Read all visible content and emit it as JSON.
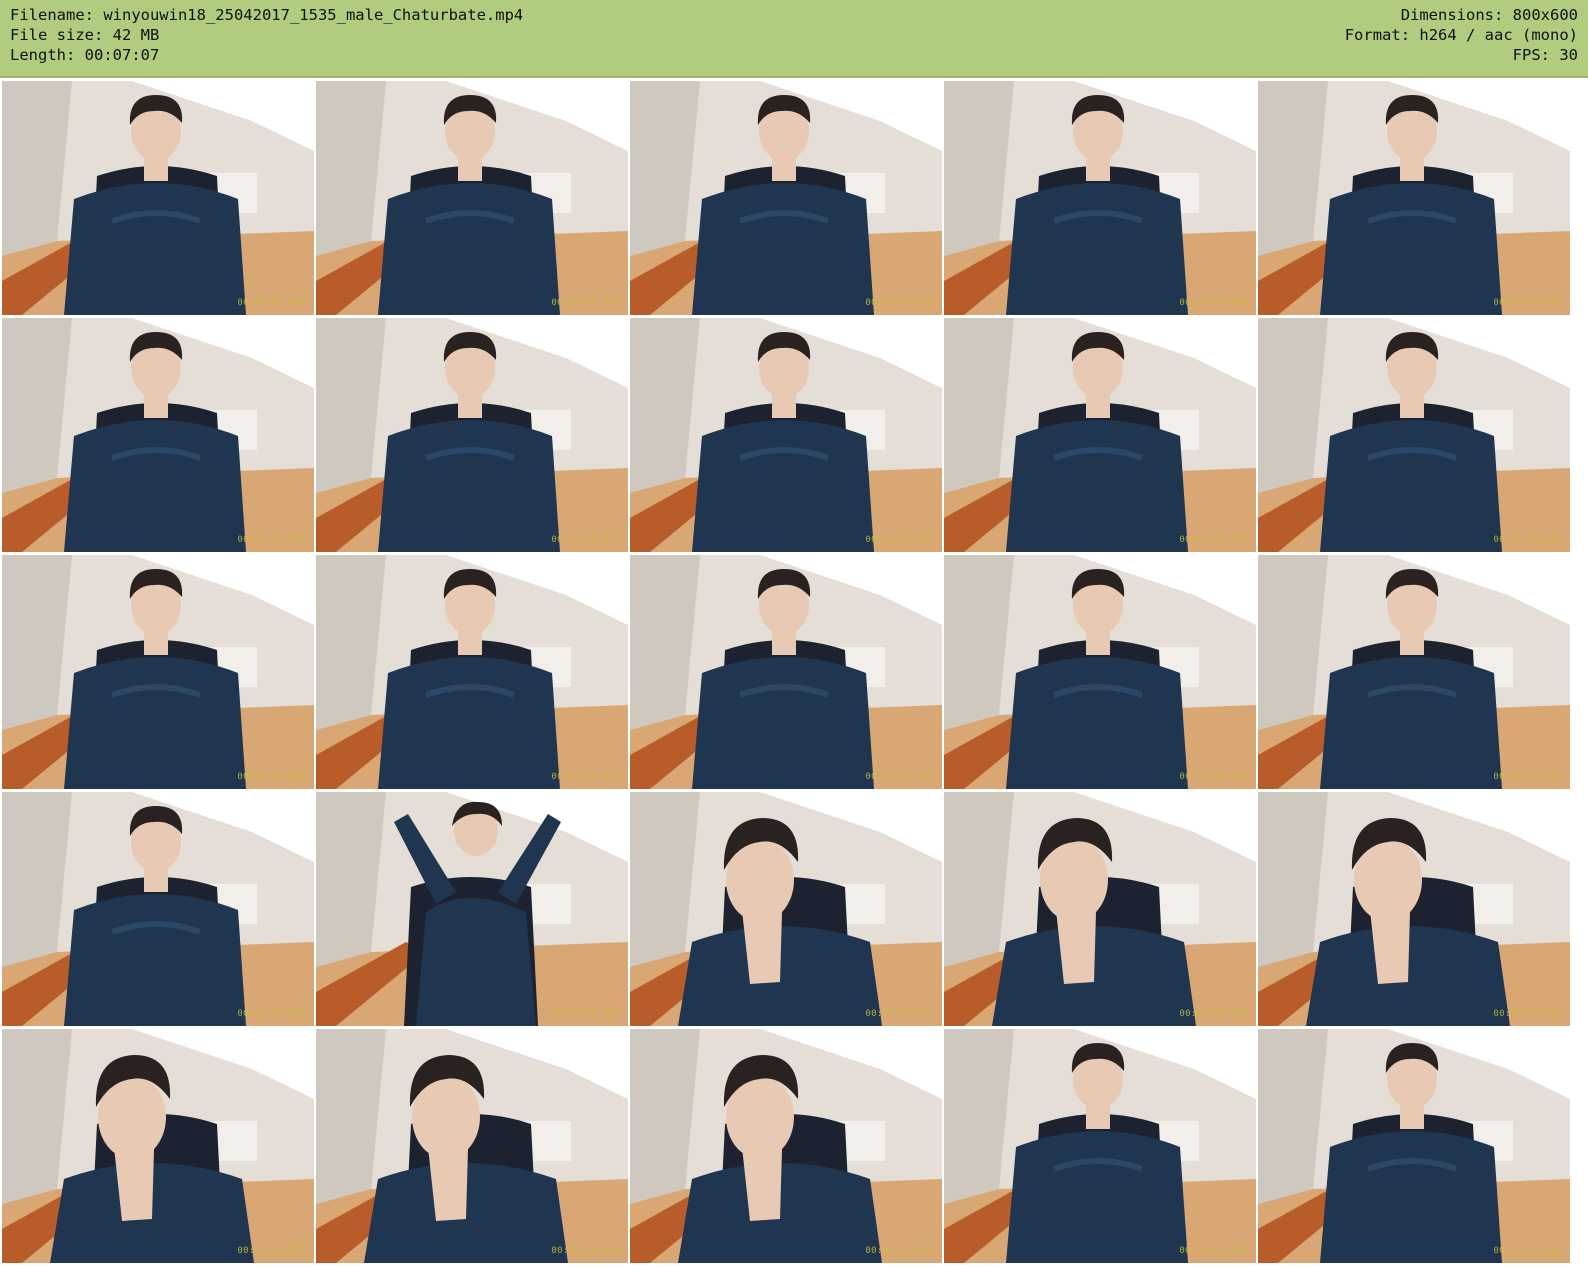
{
  "header": {
    "filename_line": "Filename: winyouwin18_25042017_1535_male_Chaturbate.mp4",
    "filesize_line": "File size: 42 MB",
    "length_line": "Length: 00:07:07",
    "dimensions_line": "Dimensions: 800x600",
    "format_line": "Format: h264 / aac (mono)",
    "fps_line": "FPS: 30"
  },
  "colors": {
    "header_bg": "#b0cc7e",
    "wall": "#e4ded6",
    "ceiling_window": "#ffffff",
    "floor": "#d8a774",
    "desk": "#b85c2a",
    "chair": "#1c2230",
    "shirt": "#1f3550",
    "skin": "#e7c9b4",
    "hair": "#2a2220",
    "timestamp": "#c8c23a"
  },
  "thumbnails": [
    {
      "timestamp": "00:00:00.000",
      "pose": "sit"
    },
    {
      "timestamp": "00:00:17.812",
      "pose": "sit"
    },
    {
      "timestamp": "00:00:35.626",
      "pose": "sit"
    },
    {
      "timestamp": "00:00:53.438",
      "pose": "sit"
    },
    {
      "timestamp": "00:01:11.251",
      "pose": "sit"
    },
    {
      "timestamp": "00:01:29.064",
      "pose": "sit"
    },
    {
      "timestamp": "00:01:46.877",
      "pose": "sit"
    },
    {
      "timestamp": "00:02:04.689",
      "pose": "sit"
    },
    {
      "timestamp": "00:02:22.502",
      "pose": "sit"
    },
    {
      "timestamp": "00:02:40.315",
      "pose": "sit"
    },
    {
      "timestamp": "00:02:58.128",
      "pose": "sit"
    },
    {
      "timestamp": "00:03:15.940",
      "pose": "sit"
    },
    {
      "timestamp": "00:03:33.753",
      "pose": "sit"
    },
    {
      "timestamp": "00:03:51.566",
      "pose": "sit"
    },
    {
      "timestamp": "00:04:09.379",
      "pose": "sit"
    },
    {
      "timestamp": "00:04:27.191",
      "pose": "sit"
    },
    {
      "timestamp": "00:04:45.004",
      "pose": "stretch"
    },
    {
      "timestamp": "00:05:02.817",
      "pose": "chin"
    },
    {
      "timestamp": "00:05:20.630",
      "pose": "chin"
    },
    {
      "timestamp": "00:05:38.442",
      "pose": "chin"
    },
    {
      "timestamp": "00:05:56.255",
      "pose": "chin"
    },
    {
      "timestamp": "00:06:14.068",
      "pose": "chin"
    },
    {
      "timestamp": "00:06:31.881",
      "pose": "chin"
    },
    {
      "timestamp": "00:06:49.693",
      "pose": "sit"
    },
    {
      "timestamp": "00:07:07.506",
      "pose": "sit"
    }
  ]
}
